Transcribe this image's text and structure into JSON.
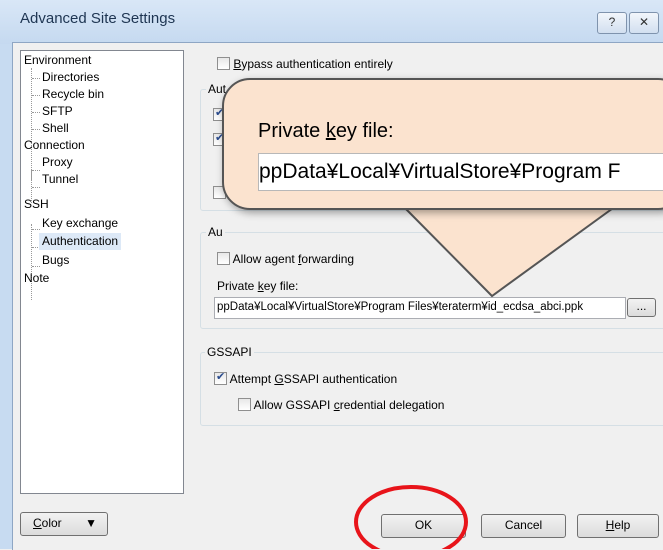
{
  "window": {
    "title": "Advanced Site Settings",
    "help_btn": "?",
    "close_btn": "✕"
  },
  "tree": {
    "environment": "Environment",
    "directories": "Directories",
    "recycle_bin": "Recycle bin",
    "sftp": "SFTP",
    "shell": "Shell",
    "connection": "Connection",
    "proxy": "Proxy",
    "tunnel": "Tunnel",
    "ssh": "SSH",
    "key_exchange": "Key exchange",
    "authentication": "Authentication",
    "bugs": "Bugs",
    "note": "Note"
  },
  "auth": {
    "bypass": "ypass authentication entirely",
    "bypass_key": "B",
    "auth_group_label": "Aut",
    "params_group_label": "Au",
    "allow_agent_pre": "Allow agent ",
    "allow_agent_key": "f",
    "allow_agent_post": "orwarding",
    "private_key_pre": "Private ",
    "private_key_key": "k",
    "private_key_post": "ey file:",
    "private_key_value": "ppData¥Local¥VirtualStore¥Program Files¥teraterm¥id_ecdsa_abci.ppk",
    "browse_label": "...",
    "gssapi_label": "GSSAPI",
    "attempt_gssapi_pre": "Attempt ",
    "attempt_gssapi_key": "G",
    "attempt_gssapi_post": "SSAPI authentication",
    "allow_gssapi_pre": "Allow GSSAPI ",
    "allow_gssapi_key": "c",
    "allow_gssapi_post": "redential delegation"
  },
  "callout": {
    "label_pre": "Private ",
    "label_key": "k",
    "label_post": "ey file:",
    "value": "ppData¥Local¥VirtualStore¥Program F"
  },
  "buttons": {
    "color_key": "C",
    "color_post": "olor",
    "ok": "OK",
    "cancel": "Cancel",
    "help_key": "H",
    "help_post": "elp"
  },
  "colors": {
    "callout_fill": "#fbe3cf",
    "highlight_circle": "#e8141a",
    "tree_selection": "#dde9f7"
  }
}
